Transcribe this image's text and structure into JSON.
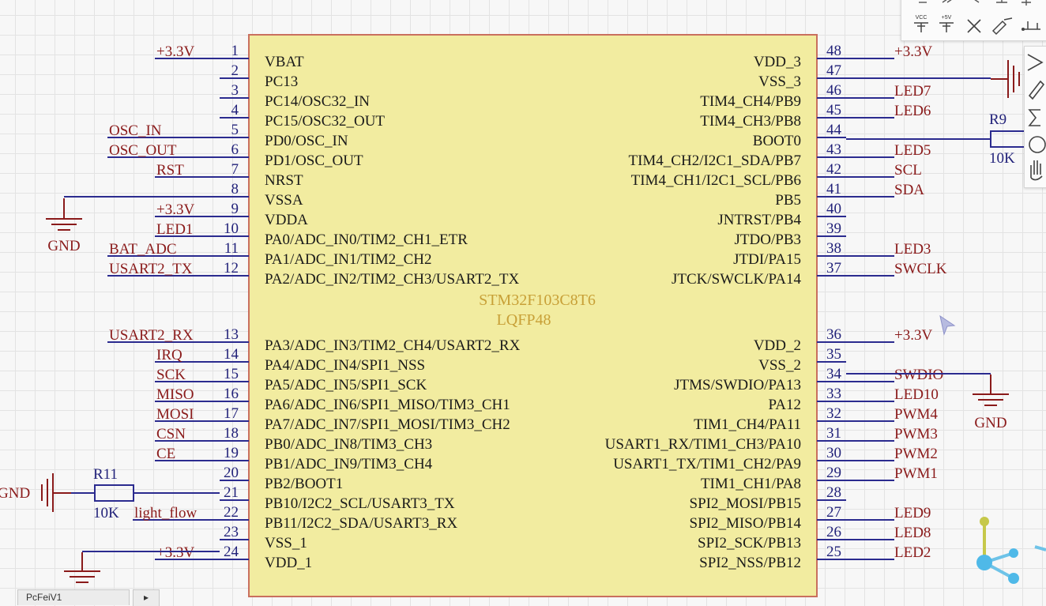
{
  "chip": {
    "part": "STM32F103C8T6",
    "package": "LQFP48",
    "body_color": "#f2eca0",
    "border_color": "#c96f5e",
    "part_color": "#c8a037",
    "pin_color": "#22227a",
    "net_color": "#8a1a1a",
    "wire_color": "#2b2b8f"
  },
  "left_pins": [
    {
      "num": "1",
      "name": "VBAT",
      "net": "+3.3V"
    },
    {
      "num": "2",
      "name": "PC13",
      "net": ""
    },
    {
      "num": "3",
      "name": "PC14/OSC32_IN",
      "net": ""
    },
    {
      "num": "4",
      "name": "PC15/OSC32_OUT",
      "net": ""
    },
    {
      "num": "5",
      "name": "PD0/OSC_IN",
      "net": "OSC_IN"
    },
    {
      "num": "6",
      "name": "PD1/OSC_OUT",
      "net": "OSC_OUT"
    },
    {
      "num": "7",
      "name": "NRST",
      "net": "RST"
    },
    {
      "num": "8",
      "name": "VSSA",
      "net": ""
    },
    {
      "num": "9",
      "name": "VDDA",
      "net": "+3.3V"
    },
    {
      "num": "10",
      "name": "PA0/ADC_IN0/TIM2_CH1_ETR",
      "net": "LED1"
    },
    {
      "num": "11",
      "name": "PA1/ADC_IN1/TIM2_CH2",
      "net": "BAT_ADC"
    },
    {
      "num": "12",
      "name": "PA2/ADC_IN2/TIM2_CH3/USART2_TX",
      "net": "USART2_TX"
    },
    {
      "num": "13",
      "name": "PA3/ADC_IN3/TIM2_CH4/USART2_RX",
      "net": "USART2_RX"
    },
    {
      "num": "14",
      "name": "PA4/ADC_IN4/SPI1_NSS",
      "net": "IRQ"
    },
    {
      "num": "15",
      "name": "PA5/ADC_IN5/SPI1_SCK",
      "net": "SCK"
    },
    {
      "num": "16",
      "name": "PA6/ADC_IN6/SPI1_MISO/TIM3_CH1",
      "net": "MISO"
    },
    {
      "num": "17",
      "name": "PA7/ADC_IN7/SPI1_MOSI/TIM3_CH2",
      "net": "MOSI"
    },
    {
      "num": "18",
      "name": "PB0/ADC_IN8/TIM3_CH3",
      "net": "CSN"
    },
    {
      "num": "19",
      "name": "PB1/ADC_IN9/TIM3_CH4",
      "net": "CE"
    },
    {
      "num": "20",
      "name": "PB2/BOOT1",
      "net": ""
    },
    {
      "num": "21",
      "name": "PB10/I2C2_SCL/USART3_TX",
      "net": ""
    },
    {
      "num": "22",
      "name": "PB11/I2C2_SDA/USART3_RX",
      "net": "light_flow"
    },
    {
      "num": "23",
      "name": "VSS_1",
      "net": ""
    },
    {
      "num": "24",
      "name": "VDD_1",
      "net": "+3.3V"
    }
  ],
  "right_pins": [
    {
      "num": "48",
      "name": "VDD_3",
      "net": "+3.3V"
    },
    {
      "num": "47",
      "name": "VSS_3",
      "net": ""
    },
    {
      "num": "46",
      "name": "TIM4_CH4/PB9",
      "net": "LED7"
    },
    {
      "num": "45",
      "name": "TIM4_CH3/PB8",
      "net": "LED6"
    },
    {
      "num": "44",
      "name": "BOOT0",
      "net": ""
    },
    {
      "num": "43",
      "name": "TIM4_CH2/I2C1_SDA/PB7",
      "net": "LED5"
    },
    {
      "num": "42",
      "name": "TIM4_CH1/I2C1_SCL/PB6",
      "net": "SCL"
    },
    {
      "num": "41",
      "name": "PB5",
      "net": "SDA"
    },
    {
      "num": "40",
      "name": "JNTRST/PB4",
      "net": ""
    },
    {
      "num": "39",
      "name": "JTDO/PB3",
      "net": ""
    },
    {
      "num": "38",
      "name": "JTDI/PA15",
      "net": "LED3"
    },
    {
      "num": "37",
      "name": "JTCK/SWCLK/PA14",
      "net": "SWCLK"
    },
    {
      "num": "36",
      "name": "VDD_2",
      "net": "+3.3V"
    },
    {
      "num": "35",
      "name": "VSS_2",
      "net": ""
    },
    {
      "num": "34",
      "name": "JTMS/SWDIO/PA13",
      "net": "SWDIO"
    },
    {
      "num": "33",
      "name": "PA12",
      "net": "LED10"
    },
    {
      "num": "32",
      "name": "TIM1_CH4/PA11",
      "net": "PWM4"
    },
    {
      "num": "31",
      "name": "USART1_RX/TIM1_CH3/PA10",
      "net": "PWM3"
    },
    {
      "num": "30",
      "name": "USART1_TX/TIM1_CH2/PA9",
      "net": "PWM2"
    },
    {
      "num": "29",
      "name": "TIM1_CH1/PA8",
      "net": "PWM1"
    },
    {
      "num": "28",
      "name": "SPI2_MOSI/PB15",
      "net": ""
    },
    {
      "num": "27",
      "name": "SPI2_MISO/PB14",
      "net": "LED9"
    },
    {
      "num": "26",
      "name": "SPI2_SCK/PB13",
      "net": "LED8"
    },
    {
      "num": "25",
      "name": "SPI2_NSS/PB12",
      "net": "LED2"
    }
  ],
  "gnd_labels": {
    "vssa": "GND",
    "vss2": "GND",
    "r11": "GND"
  },
  "resistors": {
    "r9": {
      "ref": "R9",
      "value": "10K"
    },
    "r11": {
      "ref": "R11",
      "value": "10K"
    }
  },
  "toolbar": {
    "vcc": "VCC",
    "plus5v": "+5V"
  },
  "tabs": {
    "doc": "PcFeiV1",
    "more": "▸"
  }
}
